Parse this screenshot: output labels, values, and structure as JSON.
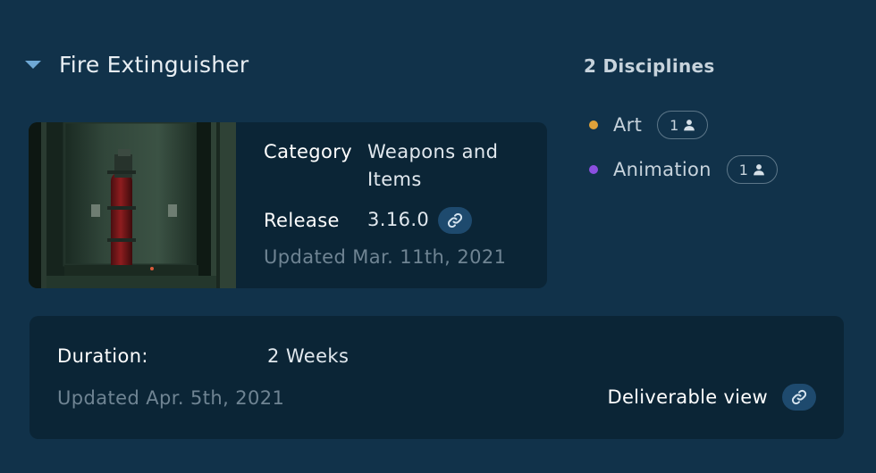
{
  "item": {
    "title": "Fire Extinguisher"
  },
  "info": {
    "category_label": "Category",
    "category_value": "Weapons and Items",
    "release_label": "Release",
    "release_value": "3.16.0",
    "updated": "Updated Mar. 11th, 2021"
  },
  "disciplines": {
    "title": "2 Disciplines",
    "items": [
      {
        "label": "Art",
        "count": "1",
        "color": "#e0a23a"
      },
      {
        "label": "Animation",
        "count": "1",
        "color": "#8b4fe0"
      }
    ]
  },
  "schedule": {
    "duration_label": "Duration:",
    "duration_value": "2 Weeks",
    "updated": "Updated Apr. 5th, 2021",
    "deliverable_label": "Deliverable view"
  },
  "colors": {
    "background": "#11324a",
    "card": "#0b2536",
    "link_button": "#1e4a6e"
  }
}
